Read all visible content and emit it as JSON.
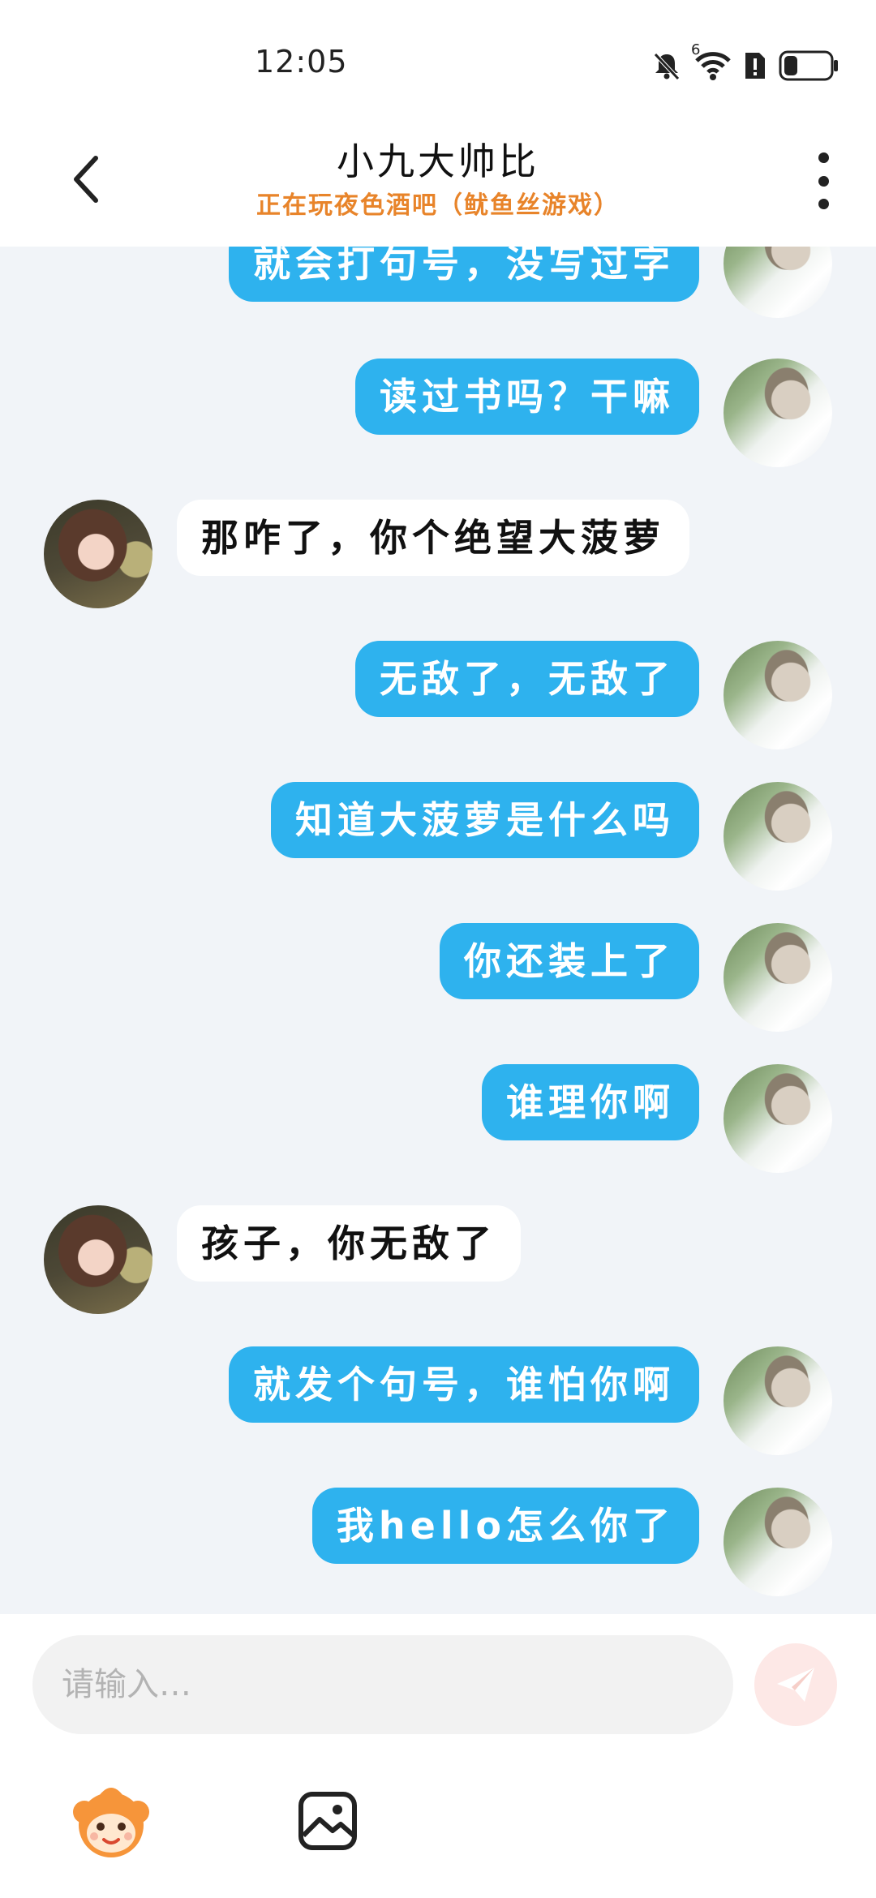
{
  "status_bar": {
    "time": "12:05",
    "icons": [
      "mute-bell-icon",
      "wifi-icon",
      "alert-sim-icon",
      "battery-icon"
    ],
    "wifi_label": "6"
  },
  "header": {
    "title": "小九大帅比",
    "subtitle": "正在玩夜色酒吧（鱿鱼丝游戏）"
  },
  "messages": [
    {
      "from": "me",
      "text": "就会打句号，没写过字"
    },
    {
      "from": "me",
      "text": "读过书吗？干嘛"
    },
    {
      "from": "them",
      "text": "那咋了，你个绝望大菠萝"
    },
    {
      "from": "me",
      "text": "无敌了，无敌了"
    },
    {
      "from": "me",
      "text": "知道大菠萝是什么吗"
    },
    {
      "from": "me",
      "text": "你还装上了"
    },
    {
      "from": "me",
      "text": "谁理你啊"
    },
    {
      "from": "them",
      "text": "孩子，你无敌了"
    },
    {
      "from": "me",
      "text": "就发个句号，谁怕你啊"
    },
    {
      "from": "me",
      "text": "我hello怎么你了"
    }
  ],
  "composer": {
    "placeholder": "请输入…",
    "value": ""
  },
  "colors": {
    "my_bubble": "#2eb2ee",
    "their_bubble": "#ffffff",
    "chat_background": "#f1f4f8",
    "subtitle": "#e8842a",
    "send_button": "#fde8e6"
  }
}
